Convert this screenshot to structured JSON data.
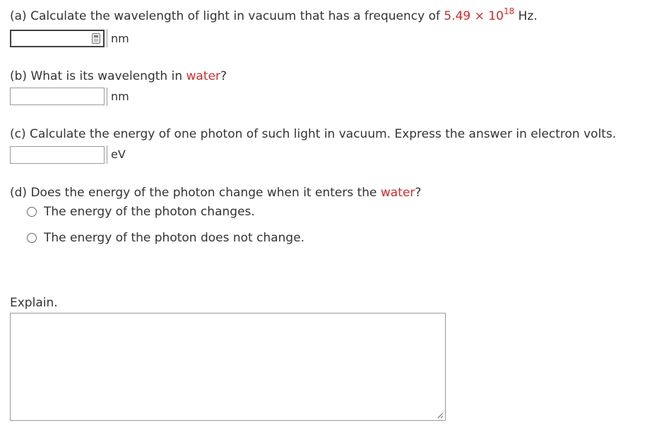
{
  "part_a": {
    "prefix": "(a) Calculate the wavelength of light in vacuum that has a frequency of ",
    "value_mantissa": "5.49",
    "times": " × 10",
    "exponent": "18",
    "suffix": " Hz.",
    "answer_value": "",
    "unit": "nm"
  },
  "part_b": {
    "prefix": "(b) What is its wavelength in ",
    "highlight": "water",
    "suffix": "?",
    "answer_value": "",
    "unit": "nm"
  },
  "part_c": {
    "text": "(c) Calculate the energy of one photon of such light in vacuum. Express the answer in electron volts.",
    "answer_value": "",
    "unit": "eV"
  },
  "part_d": {
    "prefix": "(d) Does the energy of the photon change when it enters the ",
    "highlight": "water",
    "suffix": "?",
    "options": [
      {
        "label": "The energy of the photon changes."
      },
      {
        "label": "The energy of the photon does not change."
      }
    ]
  },
  "explain": {
    "label": "Explain.",
    "value": ""
  },
  "colors": {
    "highlight": "#d42a2a",
    "text": "#333333",
    "border": "#9a9a9a"
  },
  "icons": {
    "calculator": "calculator-icon",
    "resize": "resize-grip-icon"
  }
}
